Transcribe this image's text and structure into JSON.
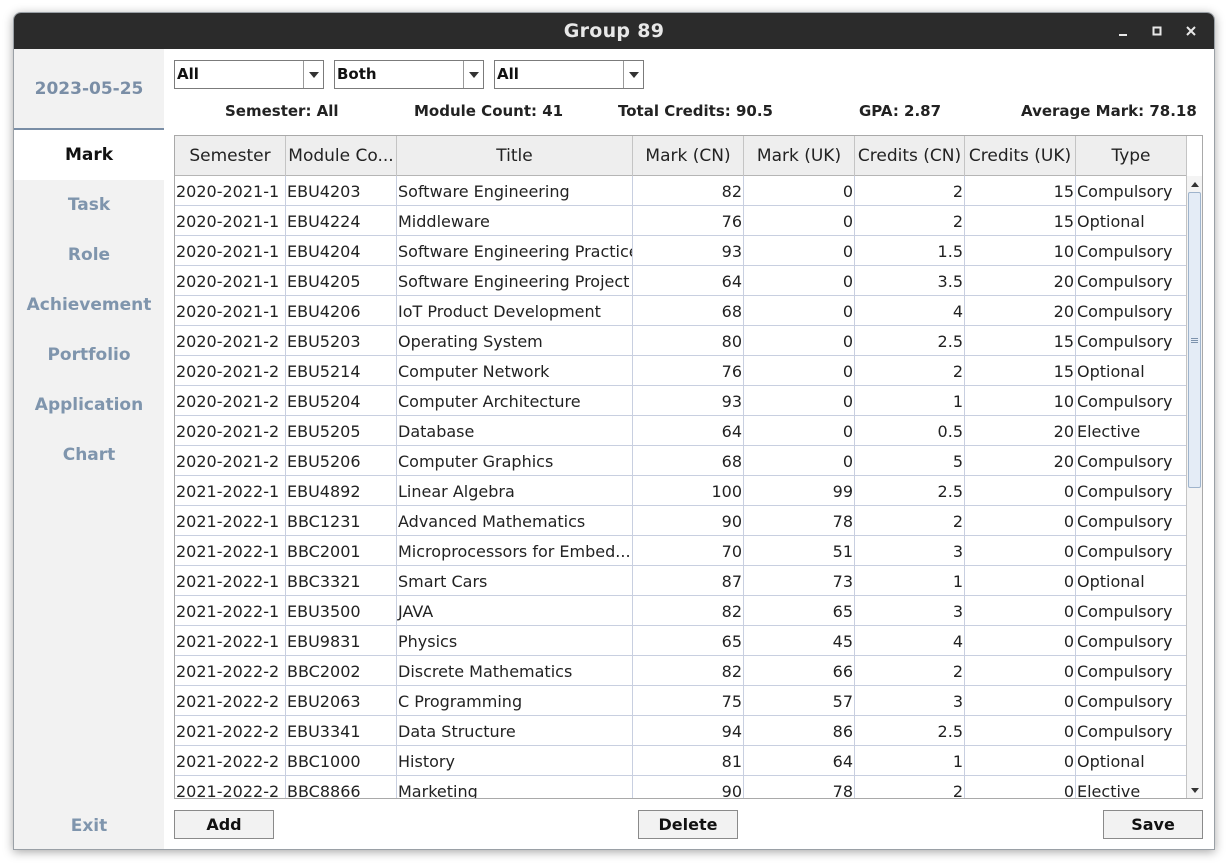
{
  "window": {
    "title": "Group 89"
  },
  "sidebar": {
    "date": "2023-05-25",
    "items": [
      {
        "label": "Mark",
        "active": true
      },
      {
        "label": "Task"
      },
      {
        "label": "Role"
      },
      {
        "label": "Achievement"
      },
      {
        "label": "Portfolio"
      },
      {
        "label": "Application"
      },
      {
        "label": "Chart"
      }
    ],
    "exit_label": "Exit"
  },
  "filters": {
    "semester": "All",
    "mark_type": "Both",
    "module_type": "All"
  },
  "stats": {
    "semester": "Semester: All",
    "module_count": "Module Count: 41",
    "total_credits": "Total Credits: 90.5",
    "gpa": "GPA: 2.87",
    "average_mark": "Average Mark: 78.18"
  },
  "table": {
    "columns": [
      "Semester",
      "Module Co...",
      "Title",
      "Mark (CN)",
      "Mark (UK)",
      "Credits (CN)",
      "Credits (UK)",
      "Type"
    ],
    "rows": [
      [
        "2020-2021-1",
        "EBU4203",
        "Software Engineering",
        "82",
        "0",
        "2",
        "15",
        "Compulsory"
      ],
      [
        "2020-2021-1",
        "EBU4224",
        "Middleware",
        "76",
        "0",
        "2",
        "15",
        "Optional"
      ],
      [
        "2020-2021-1",
        "EBU4204",
        "Software Engineering Practice",
        "93",
        "0",
        "1.5",
        "10",
        "Compulsory"
      ],
      [
        "2020-2021-1",
        "EBU4205",
        "Software Engineering Project",
        "64",
        "0",
        "3.5",
        "20",
        "Compulsory"
      ],
      [
        "2020-2021-1",
        "EBU4206",
        "IoT Product Development",
        "68",
        "0",
        "4",
        "20",
        "Compulsory"
      ],
      [
        "2020-2021-2",
        "EBU5203",
        "Operating System",
        "80",
        "0",
        "2.5",
        "15",
        "Compulsory"
      ],
      [
        "2020-2021-2",
        "EBU5214",
        "Computer Network",
        "76",
        "0",
        "2",
        "15",
        "Optional"
      ],
      [
        "2020-2021-2",
        "EBU5204",
        "Computer Architecture",
        "93",
        "0",
        "1",
        "10",
        "Compulsory"
      ],
      [
        "2020-2021-2",
        "EBU5205",
        "Database",
        "64",
        "0",
        "0.5",
        "20",
        "Elective"
      ],
      [
        "2020-2021-2",
        "EBU5206",
        "Computer Graphics",
        "68",
        "0",
        "5",
        "20",
        "Compulsory"
      ],
      [
        "2021-2022-1",
        "EBU4892",
        "Linear Algebra",
        "100",
        "99",
        "2.5",
        "0",
        "Compulsory"
      ],
      [
        "2021-2022-1",
        "BBC1231",
        "Advanced Mathematics",
        "90",
        "78",
        "2",
        "0",
        "Compulsory"
      ],
      [
        "2021-2022-1",
        "BBC2001",
        "Microprocessors for Embed...",
        "70",
        "51",
        "3",
        "0",
        "Compulsory"
      ],
      [
        "2021-2022-1",
        "BBC3321",
        "Smart Cars",
        "87",
        "73",
        "1",
        "0",
        "Optional"
      ],
      [
        "2021-2022-1",
        "EBU3500",
        "JAVA",
        "82",
        "65",
        "3",
        "0",
        "Compulsory"
      ],
      [
        "2021-2022-1",
        "EBU9831",
        "Physics",
        "65",
        "45",
        "4",
        "0",
        "Compulsory"
      ],
      [
        "2021-2022-2",
        "BBC2002",
        "Discrete Mathematics",
        "82",
        "66",
        "2",
        "0",
        "Compulsory"
      ],
      [
        "2021-2022-2",
        "EBU2063",
        "C Programming",
        "75",
        "57",
        "3",
        "0",
        "Compulsory"
      ],
      [
        "2021-2022-2",
        "EBU3341",
        "Data Structure",
        "94",
        "86",
        "2.5",
        "0",
        "Compulsory"
      ],
      [
        "2021-2022-2",
        "BBC1000",
        "History",
        "81",
        "64",
        "1",
        "0",
        "Optional"
      ],
      [
        "2021-2022-2",
        "BBC8866",
        "Marketing",
        "90",
        "78",
        "2",
        "0",
        "Elective"
      ]
    ]
  },
  "buttons": {
    "add": "Add",
    "delete": "Delete",
    "save": "Save"
  },
  "colors": {
    "title_bar": "#2b2b2b",
    "nav_text": "#7f95ad",
    "active_nav_bg": "#ffffff",
    "sidebar_bg": "#f2f2f2"
  },
  "icons": {
    "minimize": "minimize-icon",
    "maximize": "maximize-icon",
    "close": "close-icon",
    "dropdown": "chevron-down-icon",
    "scroll_up": "arrow-up-icon",
    "scroll_down": "arrow-down-icon"
  }
}
